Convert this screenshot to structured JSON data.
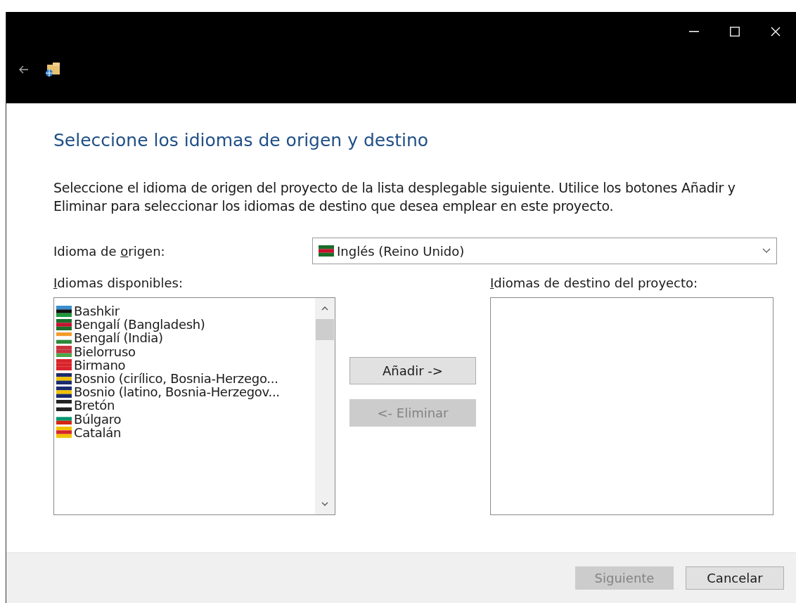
{
  "heading": "Seleccione los idiomas de origen y destino",
  "description": "Seleccione el idioma de origen del proyecto de la lista desplegable siguiente. Utilice los botones Añadir y Eliminar para seleccionar los idiomas de destino que desea emplear en este proyecto.",
  "source_language": {
    "label": {
      "before": "Idioma de ",
      "key": "o",
      "after": "rigen:"
    },
    "value": "Inglés (Reino Unido)"
  },
  "available": {
    "label": {
      "key": "I",
      "after": "diomas disponibles:"
    },
    "items": [
      {
        "name": "Bashkir"
      },
      {
        "name": "Bengalí (Bangladesh)"
      },
      {
        "name": "Bengalí (India)"
      },
      {
        "name": "Bielorruso"
      },
      {
        "name": "Birmano"
      },
      {
        "name": "Bosnio (cirílico, Bosnia-Herzego..."
      },
      {
        "name": "Bosnio (latino, Bosnia-Herzegov..."
      },
      {
        "name": "Bretón"
      },
      {
        "name": "Búlgaro"
      },
      {
        "name": "Catalán"
      }
    ]
  },
  "add_button": {
    "label": "Añadir ->",
    "disabled": false
  },
  "remove_button": {
    "label": "<- Eliminar",
    "disabled": true
  },
  "target": {
    "label": {
      "key": "I",
      "after": "diomas de destino del proyecto:"
    }
  },
  "footer_buttons": [
    {
      "label": "Siguiente",
      "disabled": true
    },
    {
      "label": "Cancelar",
      "disabled": false
    }
  ]
}
